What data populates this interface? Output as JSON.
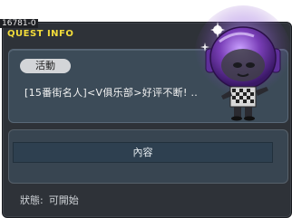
{
  "quest": {
    "id": "16781-0",
    "header": "QUEST INFO",
    "badge": "活動",
    "name": "[15番街名人]<V俱乐部>好评不断! ..",
    "content_label": "內容",
    "status_label": "狀態:",
    "status_value": "可開始"
  },
  "colors": {
    "header": "#f2dc3a",
    "window_bg": "#2e3238",
    "panel_bg": "#3c4b58",
    "npc_helmet": "#7a3fb8"
  },
  "icons": {
    "npc": "npc-purple-helmet-character"
  }
}
